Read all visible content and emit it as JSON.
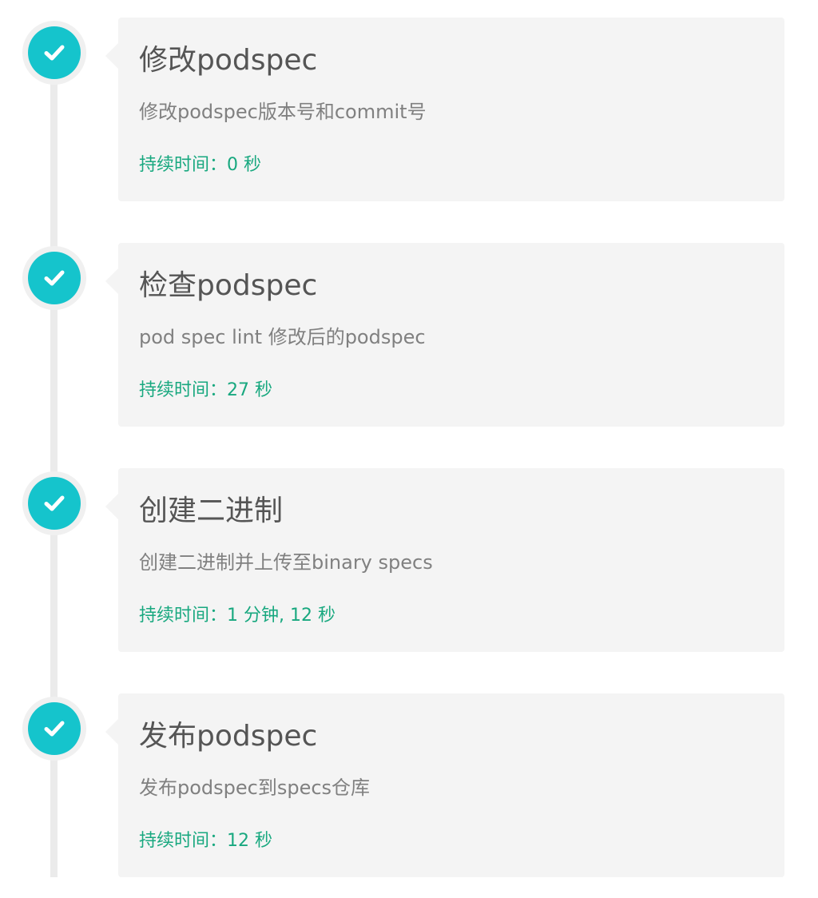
{
  "theme": {
    "marker_color": "#15c4cc",
    "duration_color": "#18a87f",
    "card_background": "#f4f4f4",
    "line_color": "#ebebeb"
  },
  "steps": [
    {
      "status_icon": "check-icon",
      "title": "修改podspec",
      "description": "修改podspec版本号和commit号",
      "duration": "持续时间：0 秒"
    },
    {
      "status_icon": "check-icon",
      "title": "检查podspec",
      "description": "pod spec lint 修改后的podspec",
      "duration": "持续时间：27 秒"
    },
    {
      "status_icon": "check-icon",
      "title": "创建二进制",
      "description": "创建二进制并上传至binary specs",
      "duration": "持续时间：1 分钟, 12 秒"
    },
    {
      "status_icon": "check-icon",
      "title": "发布podspec",
      "description": "发布podspec到specs仓库",
      "duration": "持续时间：12 秒"
    }
  ]
}
